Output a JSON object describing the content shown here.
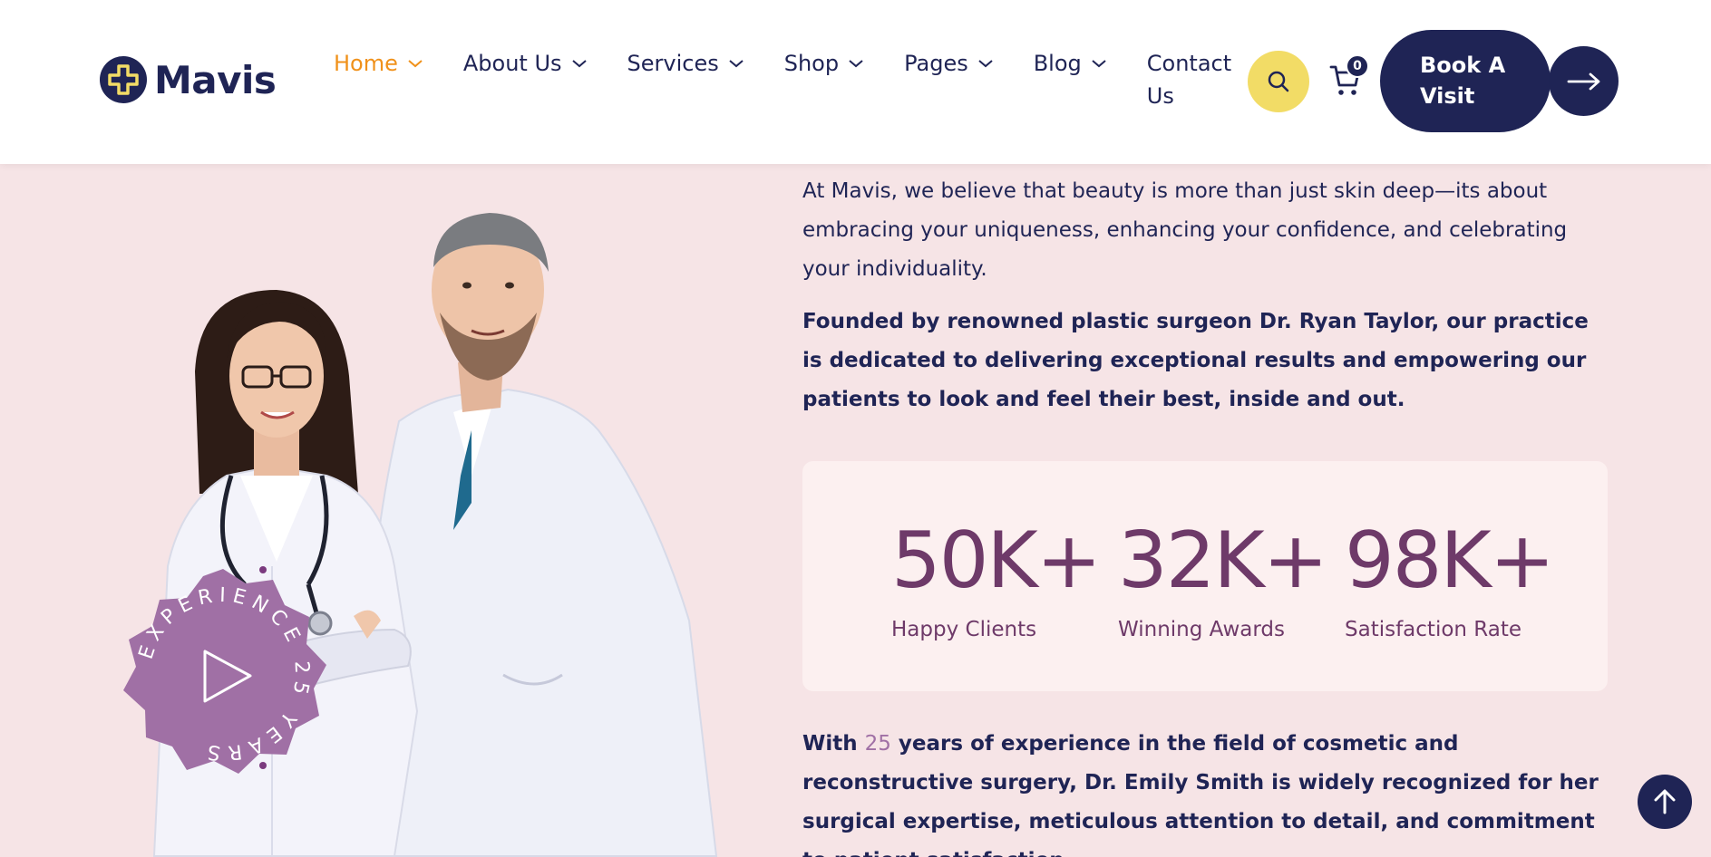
{
  "brand": {
    "name": "Mavis",
    "colors": {
      "navy": "#1f2455",
      "accent": "#f0911a",
      "yellow": "#f2dc66",
      "plum": "#6e3a69",
      "badge": "#a070a5"
    }
  },
  "nav": {
    "items": [
      {
        "label": "Home",
        "active": true,
        "has_dropdown": true
      },
      {
        "label": "About Us",
        "has_dropdown": true
      },
      {
        "label": "Services",
        "has_dropdown": true
      },
      {
        "label": "Shop",
        "has_dropdown": true
      },
      {
        "label": "Pages",
        "has_dropdown": true
      },
      {
        "label": "Blog",
        "has_dropdown": true
      },
      {
        "label": "Contact Us",
        "has_dropdown": false
      }
    ],
    "cart_count": "0",
    "book_label": "Book A Visit",
    "icons": {
      "search": "search-icon",
      "cart": "cart-icon",
      "arrow": "arrow-right-icon",
      "scroll_top": "arrow-up-icon"
    }
  },
  "badge": {
    "text": "EXPERIENCE 25 YEARS"
  },
  "intro": {
    "p1": "At Mavis, we believe that beauty is more than just skin deep—its about embracing your uniqueness, enhancing your confidence, and celebrating your individuality.",
    "p2": "Founded by renowned plastic surgeon Dr. Ryan Taylor, our practice is dedicated to delivering exceptional results and empowering our patients to look and feel their best, inside and out."
  },
  "stats": [
    {
      "value": "50K+",
      "label": "Happy Clients"
    },
    {
      "value": "32K+",
      "label": "Winning Awards"
    },
    {
      "value": "98K+",
      "label": "Satisfaction Rate"
    }
  ],
  "experience": {
    "prefix": "With ",
    "years": "25",
    "middle": " years of experience in the field of cosmetic and reconstructive surgery, ",
    "name": "Dr. Emily Smith",
    "suffix": " is widely recognized for her surgical expertise, meticulous attention to detail, and commitment to patient satisfaction."
  }
}
